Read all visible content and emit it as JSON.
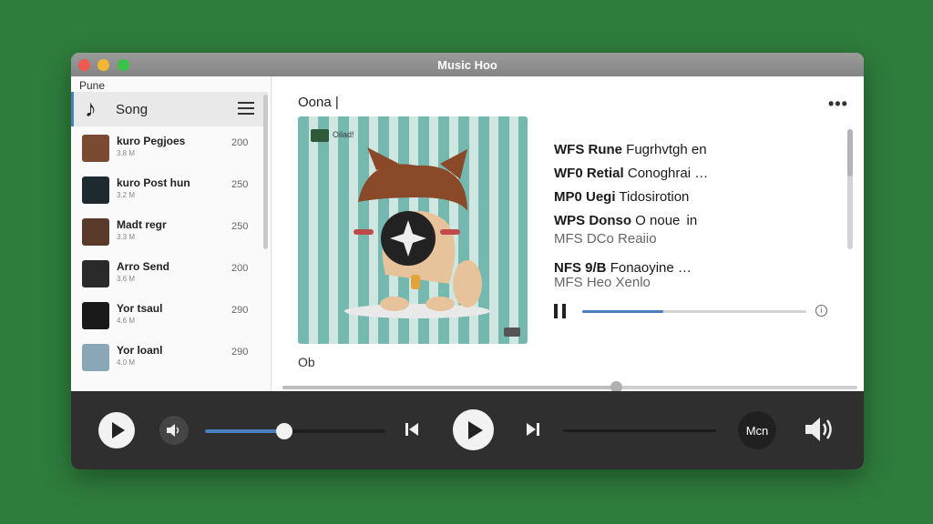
{
  "window": {
    "title": "Music Hoo"
  },
  "sidebar": {
    "label": "Pune",
    "header_title": "Song",
    "items": [
      {
        "title": "kuro Pegjoes",
        "subtitle": "3.8 M",
        "count": "200",
        "color": "#7a4a33"
      },
      {
        "title": "kuro Post hun",
        "subtitle": "3.2 M",
        "count": "250",
        "color": "#1e2a30"
      },
      {
        "title": "Madt regr",
        "subtitle": "3.3 M",
        "count": "250",
        "color": "#5a3a2a"
      },
      {
        "title": "Arro Send",
        "subtitle": "3.6 M",
        "count": "200",
        "color": "#2a2a2a"
      },
      {
        "title": "Yor tsaul",
        "subtitle": "4.6 M",
        "count": "290",
        "color": "#1a1a1a"
      },
      {
        "title": "Yor loanl",
        "subtitle": "4.0 M",
        "count": "290",
        "color": "#8aa7b8"
      }
    ]
  },
  "main": {
    "title": "Oona |",
    "footer_label": "Ob",
    "art_caption": "Oilad!",
    "tracks": [
      {
        "code": "WFS Rune",
        "name": "Fugrhvtgh en",
        "dim": false
      },
      {
        "code": "WF0 Retial",
        "name": "Conoghrai …",
        "dim": false
      },
      {
        "code": "MP0 Uegi",
        "name": "Tidosirotion",
        "dim": false
      },
      {
        "code": "WPS Donso",
        "name": "O noue  in",
        "dim": false
      },
      {
        "code": "MFS DCo",
        "name": "Reaiio",
        "dim": true
      },
      {
        "code": "NFS 9/B",
        "name": "Fonaoyine …",
        "dim": false
      },
      {
        "code": "MFS Heo",
        "name": "Xenlo",
        "dim": true
      }
    ],
    "now_playing_progress": 0.36
  },
  "player": {
    "seek_progress": 0.58,
    "volume": 0.44,
    "track_progress": 0.0,
    "mode_label": "Mcn"
  },
  "colors": {
    "accent": "#4a7fc0",
    "background": "#2e7d3c",
    "control_bar": "#2f2f2f"
  },
  "icons": {
    "window_controls": [
      "close-icon",
      "minimize-icon",
      "maximize-icon"
    ],
    "sidebar": [
      "music-note-icon",
      "filter-icon"
    ],
    "main": [
      "more-icon",
      "pause-icon",
      "info-icon"
    ],
    "player": [
      "play-icon",
      "volume-icon",
      "previous-icon",
      "play-icon",
      "next-icon",
      "volume-icon"
    ]
  }
}
